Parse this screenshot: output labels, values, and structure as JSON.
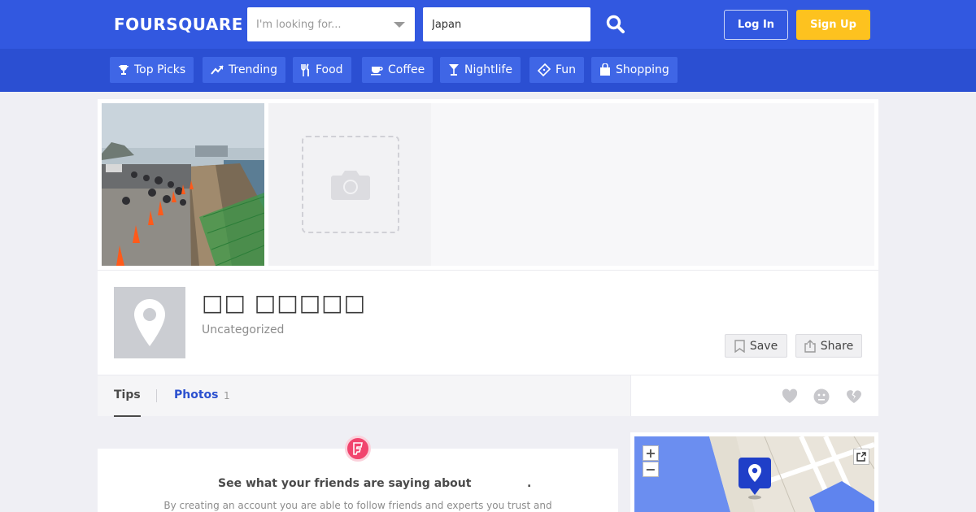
{
  "header": {
    "logo": "FOURSQUARE",
    "search_placeholder": "I'm looking for...",
    "location_value": "Japan",
    "login_label": "Log In",
    "signup_label": "Sign Up",
    "signup_color": "#fdc21f",
    "bar_color": "#3258e0"
  },
  "categories": [
    {
      "label": "Top Picks",
      "icon": "trophy-icon"
    },
    {
      "label": "Trending",
      "icon": "trending-icon"
    },
    {
      "label": "Food",
      "icon": "fork-knife-icon"
    },
    {
      "label": "Coffee",
      "icon": "coffee-cup-icon"
    },
    {
      "label": "Nightlife",
      "icon": "cocktail-icon"
    },
    {
      "label": "Fun",
      "icon": "ticket-icon"
    },
    {
      "label": "Shopping",
      "icon": "shopping-bag-icon"
    }
  ],
  "venue": {
    "name": "□□ □□□□□",
    "category": "Uncategorized",
    "save_label": "Save",
    "share_label": "Share"
  },
  "tabs": {
    "tips_label": "Tips",
    "photos_label": "Photos",
    "photos_count": "1"
  },
  "tips_panel": {
    "title": "See what your friends are saying about",
    "title_end": ".",
    "subtitle": "By creating an account you are able to follow friends and experts you trust and"
  },
  "map": {
    "zoom_in": "+",
    "zoom_out": "−"
  }
}
